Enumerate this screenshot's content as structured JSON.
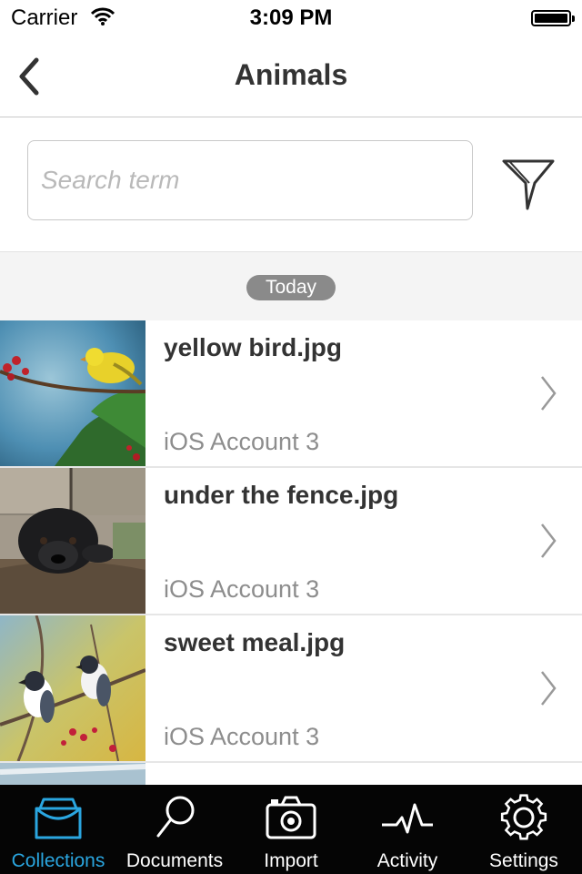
{
  "status_bar": {
    "carrier": "Carrier",
    "time": "3:09 PM",
    "wifi_icon": "wifi-icon",
    "battery_icon": "battery-icon"
  },
  "nav_bar": {
    "title": "Animals",
    "back_icon": "chevron-left-icon"
  },
  "search": {
    "value": "",
    "placeholder": "Search term",
    "filter_icon": "funnel-icon"
  },
  "section": {
    "label": "Today"
  },
  "items": [
    {
      "title": "yellow bird.jpg",
      "subtitle": "iOS Account 3",
      "thumbnail": "yellow bird photo"
    },
    {
      "title": "under the fence.jpg",
      "subtitle": "iOS Account 3",
      "thumbnail": "dog under fence photo"
    },
    {
      "title": "sweet meal.jpg",
      "subtitle": "iOS Account 3",
      "thumbnail": "birds on branch photo"
    }
  ],
  "tab_bar": {
    "active_tab": "Collections",
    "tabs": [
      {
        "label": "Collections",
        "icon": "tray-icon"
      },
      {
        "label": "Documents",
        "icon": "search-icon"
      },
      {
        "label": "Import",
        "icon": "camera-icon"
      },
      {
        "label": "Activity",
        "icon": "pulse-icon"
      },
      {
        "label": "Settings",
        "icon": "gear-icon"
      }
    ]
  },
  "colors": {
    "accent": "#2aa6e0",
    "tab_bar_background": "#050505",
    "section_pill": "#8a8a8a",
    "subtitle_text": "#8d8d8d"
  }
}
